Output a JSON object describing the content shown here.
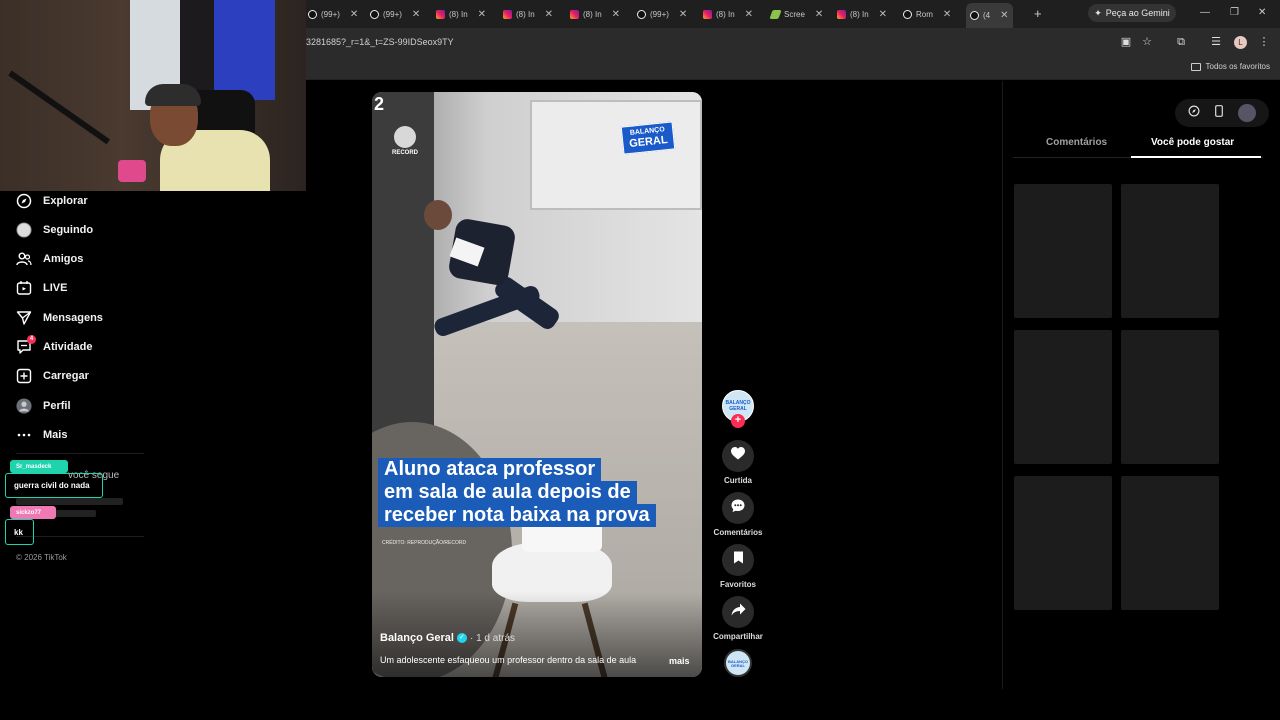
{
  "browser": {
    "tabs": [
      {
        "label": "(99+)",
        "icon": "tiktok-icon"
      },
      {
        "label": "(99+)",
        "icon": "tiktok-icon"
      },
      {
        "label": "(8) In",
        "icon": "instagram-icon"
      },
      {
        "label": "(8) In",
        "icon": "instagram-icon"
      },
      {
        "label": "(8) In",
        "icon": "instagram-icon"
      },
      {
        "label": "(99+)",
        "icon": "tiktok-icon"
      },
      {
        "label": "(8) In",
        "icon": "instagram-icon"
      },
      {
        "label": "Scree",
        "icon": "screencast-icon"
      },
      {
        "label": "(8) In",
        "icon": "instagram-icon"
      },
      {
        "label": "Rom",
        "icon": "tiktok-icon"
      },
      {
        "label": "(4",
        "icon": "tiktok-icon",
        "active": true
      }
    ],
    "gemini_label": "Peça ao Gemini",
    "url": "3281685?_r=1&_t=ZS-99IDSeox9TY",
    "profile_initial": "L",
    "bookmarks_label": "Todos os favoritos"
  },
  "sidebar": {
    "items": [
      {
        "label": "Explorar",
        "icon": "compass-icon"
      },
      {
        "label": "Seguindo",
        "icon": "following-avatar-icon"
      },
      {
        "label": "Amigos",
        "icon": "friends-icon"
      },
      {
        "label": "LIVE",
        "icon": "live-icon"
      },
      {
        "label": "Mensagens",
        "icon": "send-icon"
      },
      {
        "label": "Atividade",
        "icon": "activity-icon",
        "badge": "4"
      },
      {
        "label": "Carregar",
        "icon": "upload-icon"
      },
      {
        "label": "Perfil",
        "icon": "profile-avatar-icon"
      },
      {
        "label": "Mais",
        "icon": "more-icon"
      }
    ],
    "following_caption": "você segue",
    "copyright": "© 2026 TikTok"
  },
  "chat": {
    "messages": [
      {
        "user": "Sr_masdeck",
        "text": "guerra civil do nada",
        "color": "#1fd3ad"
      },
      {
        "user": "sickzo77",
        "text": "kk",
        "color": "#f078b4"
      }
    ]
  },
  "video": {
    "corner_number": "2",
    "record_label": "RECORD",
    "logo_top": "BALANÇO",
    "logo_bottom": "GERAL",
    "headline": [
      "Aluno ataca professor",
      "em sala de aula depois de",
      "receber nota baixa na prova"
    ],
    "credit": "CRÉDITO: REPRODUÇÃO/RECORD",
    "author": "Balanço Geral",
    "time": "· 1 d atrás",
    "description": "Um adolescente esfaqueou um professor dentro da sala de aula",
    "more": "mais"
  },
  "actions": {
    "avatar_text": "BALANÇO GERAL",
    "follow": "+",
    "buttons": [
      {
        "label": "Curtida",
        "icon": "heart-icon"
      },
      {
        "label": "Comentários",
        "icon": "comment-icon"
      },
      {
        "label": "Favoritos",
        "icon": "bookmark-icon"
      },
      {
        "label": "Compartilhar",
        "icon": "share-icon"
      }
    ]
  },
  "right_panel": {
    "tabs": [
      "Comentários",
      "Você pode gostar"
    ],
    "active_tab": 1
  },
  "colors": {
    "accent": "#fe2c55",
    "headline_bg": "#1b5cb8",
    "verified": "#20d5ec"
  }
}
